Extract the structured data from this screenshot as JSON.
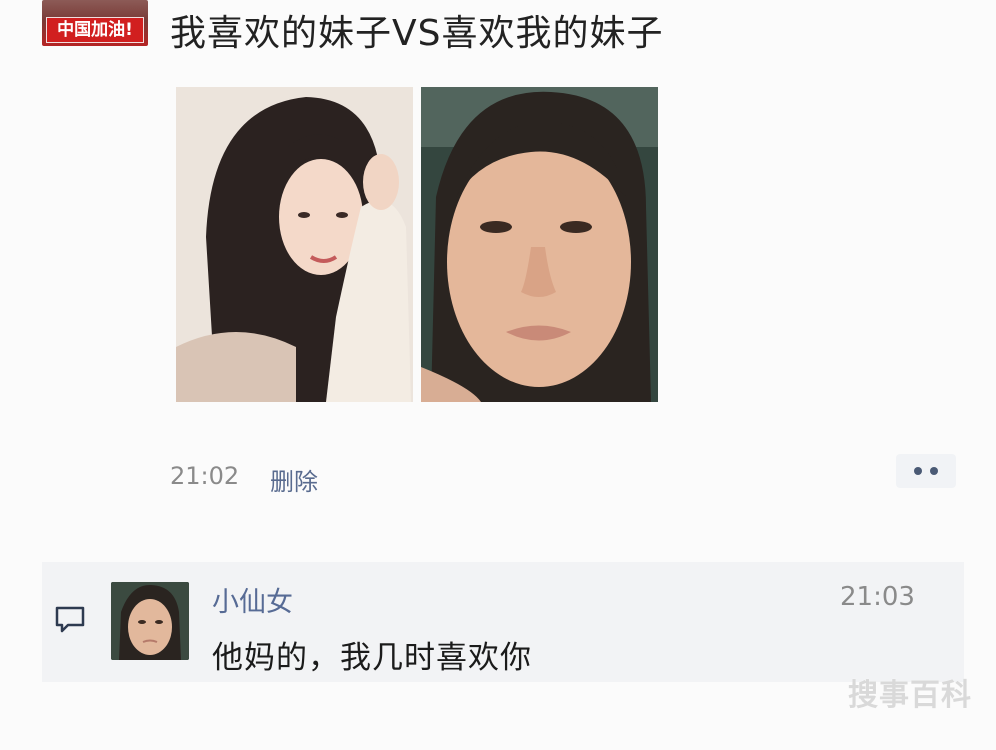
{
  "post": {
    "author_avatar_text": "中国加油!",
    "title": "我喜欢的妹子VS喜欢我的妹子",
    "images": [
      "photo-woman-long-hair",
      "photo-woman-closeup"
    ],
    "time": "21:02",
    "delete_label": "删除",
    "more_icon": "more-dots-icon"
  },
  "comment": {
    "icon": "comment-bubble-icon",
    "name": "小仙女",
    "time": "21:03",
    "text": "他妈的，我几时喜欢你"
  },
  "watermark": "搜事百科",
  "colors": {
    "link_blue": "#576b95",
    "badge_red": "#d11f1f",
    "comment_bg": "#f2f3f5"
  }
}
